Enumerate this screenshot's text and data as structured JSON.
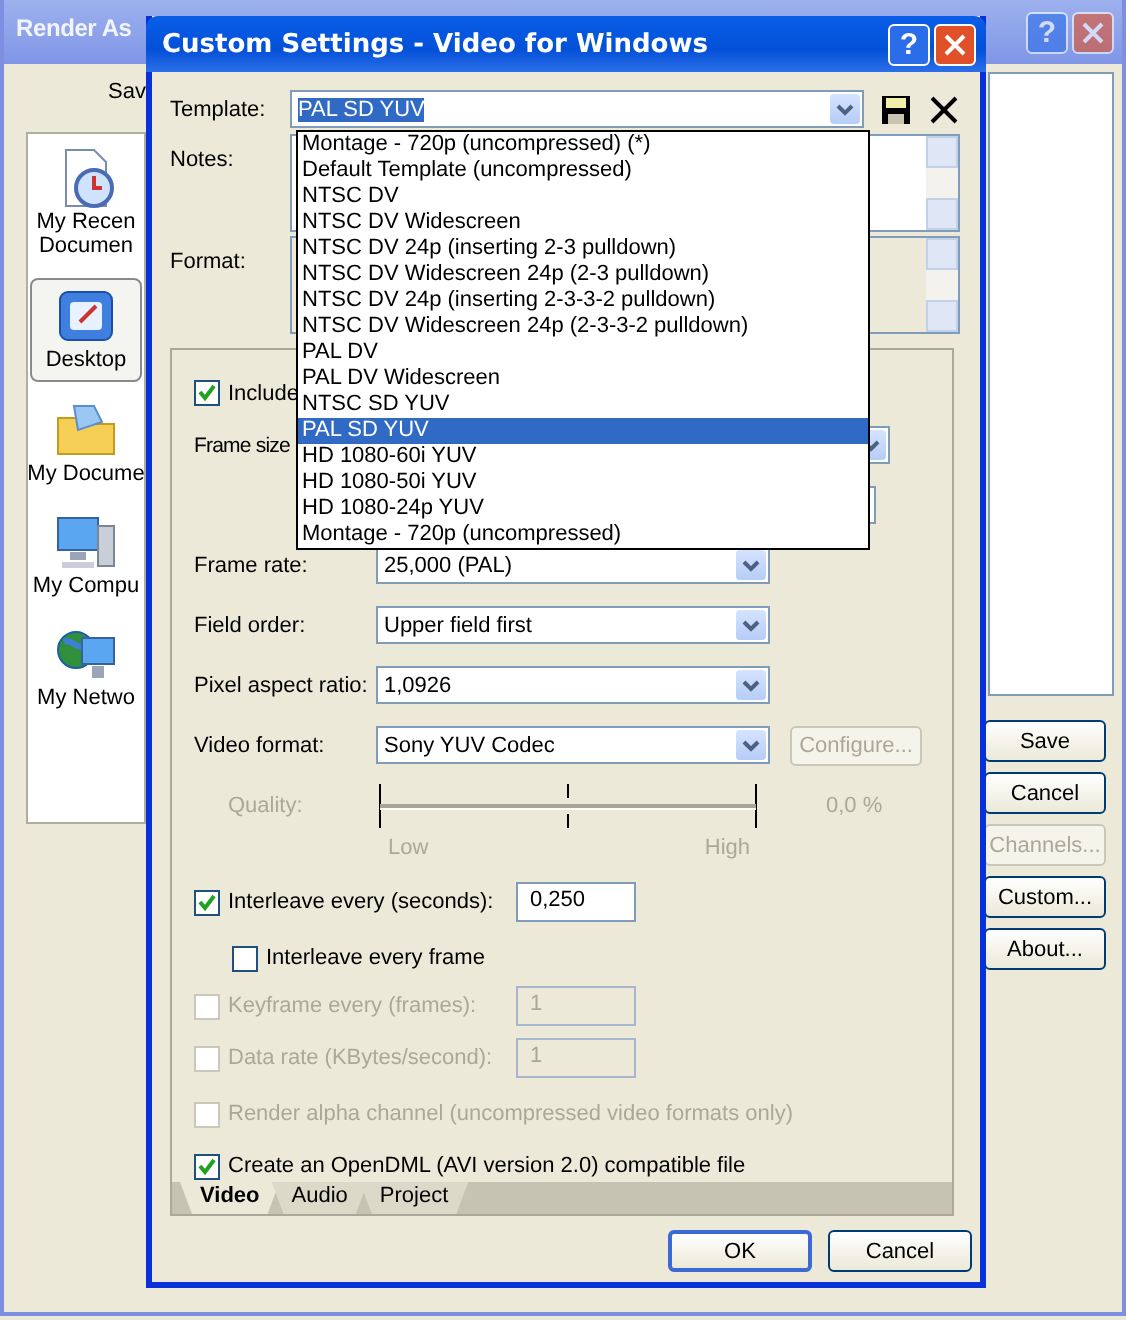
{
  "background_window": {
    "title": "Render As",
    "help_glyph": "?",
    "save_label": "Sav",
    "places": [
      {
        "lines": [
          "My Recen",
          "Documen"
        ],
        "kind": "recent",
        "selected": false
      },
      {
        "lines": [
          "Desktop"
        ],
        "kind": "desktop",
        "selected": true
      },
      {
        "lines": [
          "My Docume"
        ],
        "kind": "documents",
        "selected": false
      },
      {
        "lines": [
          "My Compu"
        ],
        "kind": "computer",
        "selected": false
      },
      {
        "lines": [
          "My Netwo"
        ],
        "kind": "network",
        "selected": false
      }
    ],
    "buttons": [
      {
        "label": "Save",
        "disabled": false
      },
      {
        "label": "Cancel",
        "disabled": false
      },
      {
        "label": "Channels...",
        "disabled": true
      },
      {
        "label": "Custom...",
        "disabled": false
      },
      {
        "label": "About...",
        "disabled": false
      }
    ]
  },
  "dialog": {
    "title": "Custom Settings - Video for Windows",
    "help_glyph": "?",
    "template": {
      "label": "Template:",
      "value": "PAL SD YUV"
    },
    "template_options": [
      {
        "label": "Montage - 720p (uncompressed) (*)",
        "selected": false
      },
      {
        "label": "Default Template (uncompressed)",
        "selected": false
      },
      {
        "label": "NTSC DV",
        "selected": false
      },
      {
        "label": "NTSC DV Widescreen",
        "selected": false
      },
      {
        "label": "NTSC DV 24p (inserting 2-3 pulldown)",
        "selected": false
      },
      {
        "label": "NTSC DV Widescreen 24p (2-3 pulldown)",
        "selected": false
      },
      {
        "label": "NTSC DV 24p (inserting 2-3-3-2 pulldown)",
        "selected": false
      },
      {
        "label": "NTSC DV Widescreen 24p (2-3-3-2 pulldown)",
        "selected": false
      },
      {
        "label": "PAL DV",
        "selected": false
      },
      {
        "label": "PAL DV Widescreen",
        "selected": false
      },
      {
        "label": "NTSC SD YUV",
        "selected": false
      },
      {
        "label": "PAL SD YUV",
        "selected": true
      },
      {
        "label": "HD 1080-60i YUV",
        "selected": false
      },
      {
        "label": "HD 1080-50i YUV",
        "selected": false
      },
      {
        "label": "HD 1080-24p YUV",
        "selected": false
      },
      {
        "label": "Montage - 720p (uncompressed)",
        "selected": false
      }
    ],
    "notes_label": "Notes:",
    "format_label": "Format:",
    "video": {
      "include": {
        "label": "Include",
        "checked": true
      },
      "frame_size_label": "Frame size",
      "frame_rate": {
        "label": "Frame rate:",
        "value": "25,000 (PAL)"
      },
      "field_order": {
        "label": "Field order:",
        "value": "Upper field first"
      },
      "pixel_aspect_ratio": {
        "label": "Pixel aspect ratio:",
        "value": "1,0926"
      },
      "video_format": {
        "label": "Video format:",
        "value": "Sony YUV Codec"
      },
      "configure_button": {
        "label": "Configure...",
        "disabled": true
      },
      "quality": {
        "label": "Quality:",
        "reading": "0,0 %",
        "low": "Low",
        "high": "High",
        "disabled": true
      },
      "options": [
        {
          "kind": "field",
          "label": "Interleave every (seconds):",
          "checked": true,
          "disabled": false,
          "value": "0,250",
          "indented": false
        },
        {
          "kind": "check",
          "label": "Interleave every frame",
          "checked": false,
          "disabled": false,
          "indented": true
        },
        {
          "kind": "field",
          "label": "Keyframe every (frames):",
          "checked": false,
          "disabled": true,
          "value": "1",
          "indented": false
        },
        {
          "kind": "field",
          "label": "Data rate (KBytes/second):",
          "checked": false,
          "disabled": true,
          "value": "1",
          "indented": false
        },
        {
          "kind": "check",
          "label": "Render alpha channel (uncompressed video formats only)",
          "checked": false,
          "disabled": true,
          "indented": false
        },
        {
          "kind": "check",
          "label": "Create an OpenDML (AVI version 2.0) compatible file",
          "checked": true,
          "disabled": false,
          "indented": false
        }
      ]
    },
    "tabs": [
      {
        "label": "Video",
        "selected": true
      },
      {
        "label": "Audio",
        "selected": false
      },
      {
        "label": "Project",
        "selected": false
      }
    ],
    "buttons": [
      {
        "label": "OK",
        "default": true
      },
      {
        "label": "Cancel",
        "default": false
      }
    ]
  }
}
